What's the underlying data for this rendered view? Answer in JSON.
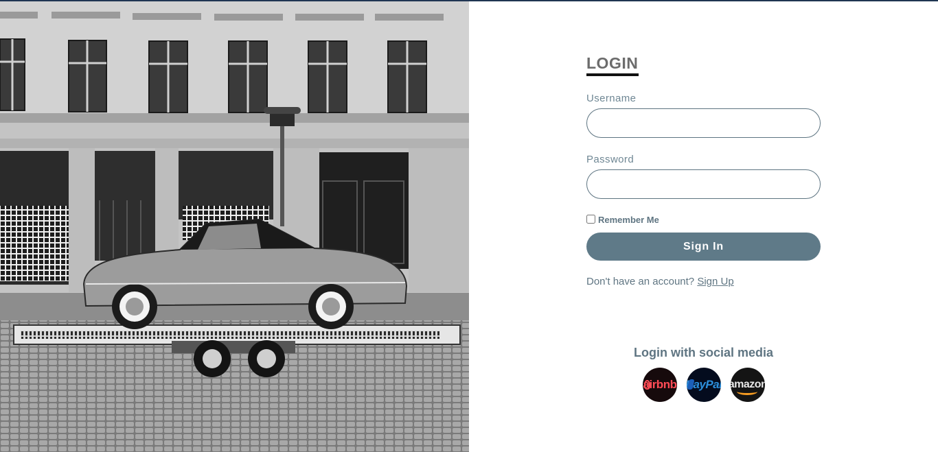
{
  "login": {
    "title": "LOGIN",
    "username_label": "Username",
    "username_value": "",
    "password_label": "Password",
    "password_value": "",
    "remember_label": "Remember Me",
    "remember_checked": false,
    "signin_label": "Sign In",
    "signup_prompt": "Don't have an account?",
    "signup_link": "Sign Up"
  },
  "social": {
    "title": "Login with social media",
    "providers": [
      {
        "name": "airbnb",
        "icon": "airbnb-icon",
        "text": "airbnb",
        "color": "#ff4b55"
      },
      {
        "name": "paypal",
        "icon": "paypal-icon",
        "text": "PayPal",
        "color": "#2c8fdc"
      },
      {
        "name": "amazon",
        "icon": "amazon-icon",
        "text": "amazon",
        "color": "#f59b22"
      }
    ]
  },
  "colors": {
    "accent": "#5f7a88",
    "topbar": "#1f3552",
    "text": "#5f7582"
  }
}
